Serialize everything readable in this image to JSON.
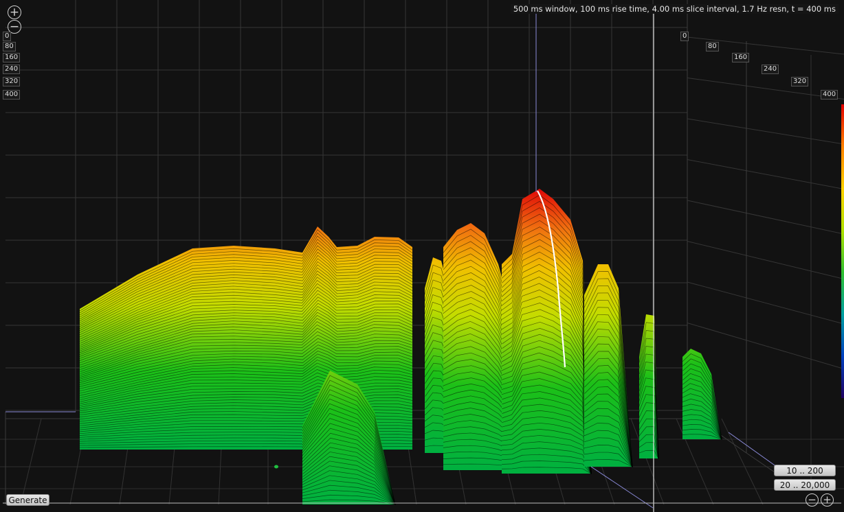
{
  "status_text": "500 ms window, 100 ms rise time, 4.00 ms slice interval, 1.7 Hz resn, t = 400 ms",
  "left_time_ticks": [
    "0",
    "80",
    "160",
    "240",
    "320",
    "400"
  ],
  "top_time_ticks": [
    "0",
    "80",
    "160",
    "240",
    "320",
    "400"
  ],
  "buttons": {
    "generate": "Generate",
    "range_low": "10 .. 200",
    "range_full": "20 .. 20,000"
  },
  "icons": {
    "zoom_in": "zoom-in-icon",
    "zoom_out": "zoom-out-icon"
  },
  "colors": {
    "background": "#121212",
    "grid": "#3a3a3a",
    "cursor": "#9a9ae0",
    "low": "#00b030",
    "mid": "#e8e000",
    "high": "#e01000"
  }
}
